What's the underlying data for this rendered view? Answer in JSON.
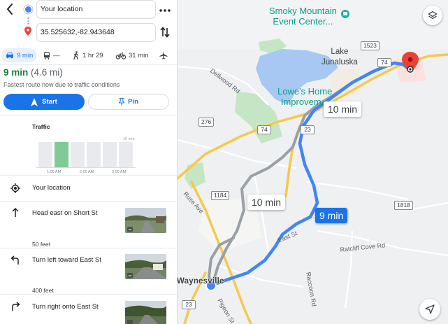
{
  "search": {
    "origin_value": "Your location",
    "destination_value": "35.525632,-82.943648"
  },
  "modes": [
    {
      "icon": "car-icon",
      "label": "9 min",
      "active": true
    },
    {
      "icon": "transit-icon",
      "label": "—",
      "active": false
    },
    {
      "icon": "walk-icon",
      "label": "1 hr 29",
      "active": false
    },
    {
      "icon": "bike-icon",
      "label": "31 min",
      "active": false
    },
    {
      "icon": "flight-icon",
      "label": "",
      "active": false
    }
  ],
  "summary": {
    "time": "9 min",
    "distance": "(4.6 mi)",
    "note": "Fastest route now due to traffic conditions"
  },
  "actions": {
    "start_label": "Start",
    "pin_label": "Pin"
  },
  "traffic": {
    "title": "Traffic",
    "ticks": [
      "1:00 AM",
      "2:00 AM",
      "3:00 AM"
    ],
    "bar_label": "10 min",
    "current_index": 1,
    "bar_levels": [
      1,
      1,
      1,
      1,
      1,
      1
    ]
  },
  "steps": [
    {
      "icon": "my-location-icon",
      "text": "Your location"
    },
    {
      "icon": "arrow-up-icon",
      "text": "Head east on Short St",
      "distance_after": "50 feet"
    },
    {
      "icon": "turn-left-icon",
      "text": "Turn left toward East St",
      "distance_after": "400 feet"
    },
    {
      "icon": "turn-right-icon",
      "text": "Turn right onto East St"
    }
  ],
  "map": {
    "poi": "Smoky Mountain\nEvent Center...",
    "lake": "Lake\nJunaluska",
    "lowes": "Lowe's Home\nImprovem...",
    "roads": {
      "dellwood": "Dellwood Rd",
      "russ": "Russ Ave",
      "eastst": "East St",
      "pigeon": "Pigeon St",
      "ratcliff": "Ratcliff Cove Rd",
      "raccoon": "Raccoon Rd"
    },
    "shields": [
      "1523",
      "74",
      "276",
      "74",
      "23",
      "1184",
      "1818",
      "23"
    ],
    "town": "Waynesville",
    "callouts": {
      "alt_top": "10 min",
      "alt_mid": "10 min",
      "main": "9 min"
    },
    "colors": {
      "route_main": "#4285f4",
      "route_alt": "#9aa0a6",
      "water": "#a7c8f2",
      "park": "#bfe3c1",
      "highway": "#f6c94a",
      "pin": "#ea4335"
    }
  }
}
